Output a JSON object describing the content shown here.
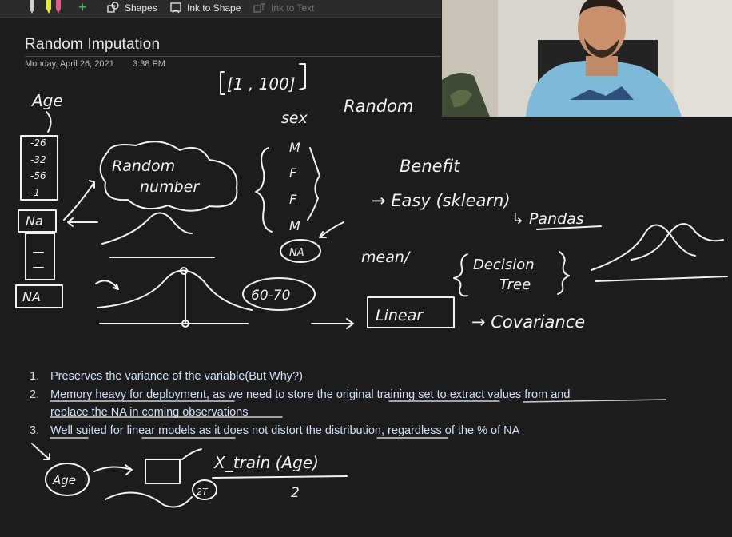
{
  "ribbon": {
    "shapes_label": "Shapes",
    "ink_to_shape_label": "Ink to Shape",
    "ink_to_text_label": "Ink to Text",
    "pen_colors": [
      "#cfcfcf",
      "#e8e83a",
      "#e05a8a"
    ],
    "add_color": "#3fbf6f"
  },
  "page": {
    "title": "Random Imputation",
    "date": "Monday, April 26, 2021",
    "time": "3:38 PM"
  },
  "ink": {
    "age": "Age",
    "age_values": [
      "-26",
      "-32",
      "-56",
      "-1"
    ],
    "na": "Na",
    "na_bottom": "NA",
    "random_number": [
      "Random",
      "number"
    ],
    "range": "[1 , 100]",
    "sex": "sex",
    "sex_values": [
      "M",
      "F",
      "F",
      "M"
    ],
    "na_circled": "NA",
    "random": "Random",
    "benefit": "Benefit",
    "easy": "→ Easy (sklearn)",
    "pandas": "↳ Pandas",
    "mean": "mean/",
    "decision_tree": [
      "Decision",
      "Tree"
    ],
    "range_6070": "60-70",
    "linear": "Linear",
    "covariance": "→ Covariance",
    "age_circle": "Age",
    "x_train": "X_train (Age)",
    "two_t": "2T",
    "denominator": "2"
  },
  "points": [
    {
      "num": "1.",
      "text": "Preserves the variance of the variable(But Why?)"
    },
    {
      "num": "2.",
      "text": "Memory heavy for deployment, as we need to store the original training set to extract values from and",
      "cont": "replace the NA in coming observations"
    },
    {
      "num": "3.",
      "text": "Well suited for linear models as it does not distort the distribution, regardless of the % of NA"
    }
  ]
}
